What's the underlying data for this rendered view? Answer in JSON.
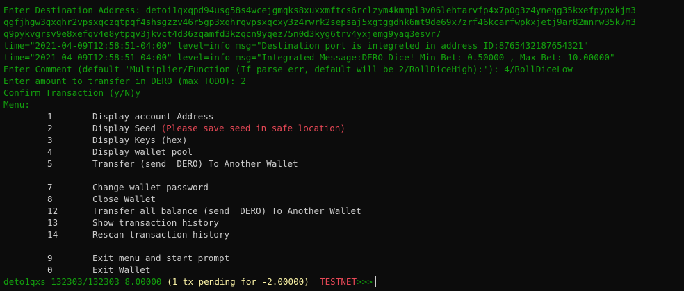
{
  "colors": {
    "background": "#0c0c0c",
    "green": "#13a10e",
    "white": "#cccccc",
    "red": "#e74856"
  },
  "output": {
    "dest_prompt": "Enter Destination Address: ",
    "dest_address_1": "detoi1qxqpd94usg58s4wcejgmqks8xuxxmftcs6rclzym4kmmpl3v06lehtarvfp4x7p0g3z4yneqg35kxefpypxkjm3",
    "dest_address_2": "qgfjhgw3qxqhr2vpsxqczqtpqf4shsgzzv46r5gp3xqhrqvpsxqcxy3z4rwrk2sepsaj5xgtggdhk6mt9de69x7zrf46kcarfwpkxjetj9ar82mnrw35k7m3",
    "dest_address_3": "q9pykvgrsv9e8xefqv4e8ytpqv3jkvct4d36zqamfd3kzqcn9yqez75n0d3kyg6trv4yxjemg9yaq3esvr7",
    "log_1": "time=\"2021-04-09T12:58:51-04:00\" level=info msg=\"Destination port is integreted in address ID:8765432187654321\"",
    "log_2": "time=\"2021-04-09T12:58:51-04:00\" level=info msg=\"Integrated Message:DERO Dice! Min Bet: 0.50000 , Max Bet: 10.00000\"",
    "comment_prompt": "Enter Comment (default 'Multiplier/Function (If parse err, default will be 2/RollDiceHigh):'): 4/RollDiceLow",
    "amount_prompt": "Enter amount to transfer in DERO (max TODO): 2",
    "confirm_prompt": "Confirm Transaction (y/N)y",
    "menu_title": "Menu:"
  },
  "menu": {
    "group1": [
      {
        "num": "1",
        "label": "Display account Address"
      },
      {
        "num": "2",
        "label": "Display Seed ",
        "warning": "(Please save seed in safe location)"
      },
      {
        "num": "3",
        "label": "Display Keys (hex)"
      },
      {
        "num": "4",
        "label": "Display wallet pool"
      },
      {
        "num": "5",
        "label": "Transfer (send  DERO) To Another Wallet"
      }
    ],
    "group2": [
      {
        "num": "7",
        "label": "Change wallet password"
      },
      {
        "num": "8",
        "label": "Close Wallet"
      },
      {
        "num": "12",
        "label": "Transfer all balance (send  DERO) To Another Wallet"
      },
      {
        "num": "13",
        "label": "Show transaction history"
      },
      {
        "num": "14",
        "label": "Rescan transaction history"
      }
    ],
    "group3": [
      {
        "num": "9",
        "label": "Exit menu and start prompt"
      },
      {
        "num": "0",
        "label": "Exit Wallet"
      }
    ]
  },
  "status": {
    "wallet_id": "deto1qxs",
    "height": "132303/132303",
    "balance": "8.00000",
    "pending": "(1 tx pending for -2.00000)",
    "network": "TESTNET",
    "prompt": ">>>"
  }
}
